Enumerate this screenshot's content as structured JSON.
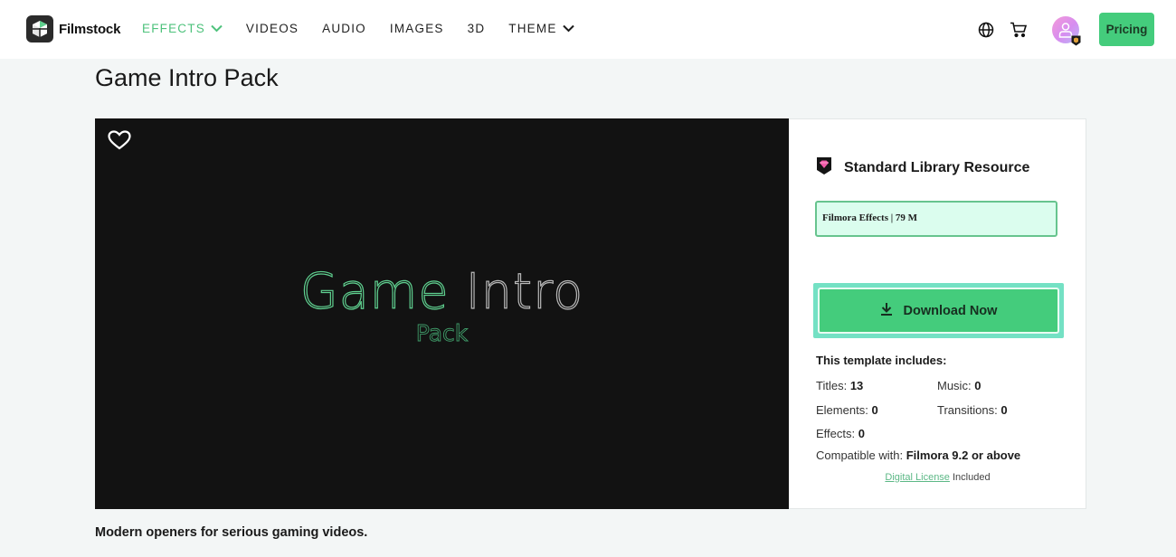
{
  "nav": {
    "brand": "Filmstock",
    "menu": [
      {
        "label": "EFFECTS",
        "active": true,
        "has_dropdown": true
      },
      {
        "label": "VIDEOS",
        "active": false,
        "has_dropdown": false
      },
      {
        "label": "AUDIO",
        "active": false,
        "has_dropdown": false
      },
      {
        "label": "IMAGES",
        "active": false,
        "has_dropdown": false
      },
      {
        "label": "3D",
        "active": false,
        "has_dropdown": false
      },
      {
        "label": "THEME",
        "active": false,
        "has_dropdown": true
      }
    ],
    "icons": [
      "globe-icon",
      "cart-icon",
      "avatar"
    ],
    "pricing_label": "Pricing"
  },
  "page": {
    "title": "Game Intro Pack",
    "description": "Modern openers for serious gaming videos."
  },
  "preview": {
    "title_part1": "Game",
    "title_part2": " Intro",
    "subtitle": "Pack",
    "favorite_icon": "heart-icon"
  },
  "panel": {
    "resource_type": "Standard Library Resource",
    "info_box": "Filmora Effects | 79 M",
    "download_label": "Download Now",
    "includes_title": "This template includes:",
    "items": [
      {
        "label": "Titles:",
        "value": "13"
      },
      {
        "label": "Music:",
        "value": "0"
      },
      {
        "label": "Elements:",
        "value": "0"
      },
      {
        "label": "Transitions:",
        "value": "0"
      },
      {
        "label": "Effects:",
        "value": "0"
      }
    ],
    "compatible_label": "Compatible with:",
    "compatible_value": "Filmora 9.2 or above",
    "license_link": "Digital License",
    "license_suffix": " Included"
  },
  "colors": {
    "accent": "#44cc7c",
    "accent_outline": "#74e1c4",
    "info_bg": "#dbfdee"
  }
}
